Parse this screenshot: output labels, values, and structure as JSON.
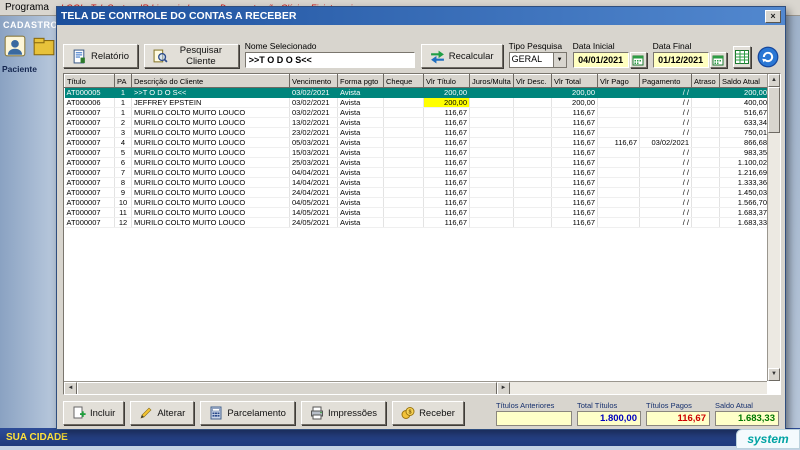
{
  "colors": {
    "titlebar_start": "#1c4f9c",
    "titlebar_end": "#5288cf",
    "selected_row": "#00857c",
    "highlight_yellow": "#ffff00",
    "date_field_bg": "#ffffc0",
    "summary_box_bg": "#ffffc8",
    "statusbar_bg": "#203a7c",
    "status_text": "#ffe23c"
  },
  "app": {
    "menu": "Programa",
    "license_text": "LOGI - TelaSystem IR  Licenciado para: Demonstração Clínica Fisioterapia",
    "sidebar": {
      "group": "CADASTROS",
      "item": "Paciente"
    },
    "statusbar_text": "SUA CIDADE",
    "logo_text": "system"
  },
  "dialog": {
    "title": "TELA DE CONTROLE DO CONTAS A RECEBER",
    "toolbar": {
      "relatorio": "Relatório",
      "pesquisar": "Pesquisar Cliente",
      "nome_label": "Nome Selecionado",
      "nome_value": ">>T O D O S<<",
      "recalcular": "Recalcular",
      "tipo_label": "Tipo Pesquisa",
      "tipo_value": "GERAL",
      "data_inicial_label": "Data Inicial",
      "data_inicial": "04/01/2021",
      "data_final_label": "Data Final",
      "data_final": "01/12/2021"
    },
    "grid": {
      "columns": [
        "Título",
        "PA",
        "Descrição do Cliente",
        "Vencimento",
        "Forma pgto",
        "Cheque",
        "Vlr Título",
        "Juros/Multa",
        "Vlr Desc.",
        "Vlr Total",
        "Vlr Pago",
        "Pagamento",
        "Atraso",
        "Saldo Atual"
      ],
      "selected_row_index": 0,
      "highlighted_cell": {
        "row": 1,
        "col": 6,
        "color": "#ffff00"
      },
      "rows": [
        [
          "AT000005",
          "1",
          ">>T O D O S<<",
          "03/02/2021",
          "Avista",
          "",
          "200,00",
          "",
          "",
          "200,00",
          "",
          "/ /",
          "",
          "200,00"
        ],
        [
          "AT000006",
          "1",
          "JEFFREY EPSTEIN",
          "03/02/2021",
          "Avista",
          "",
          "200,00",
          "",
          "",
          "200,00",
          "",
          "/ /",
          "",
          "400,00"
        ],
        [
          "AT000007",
          "1",
          "MURILO COLTO MUITO LOUCO",
          "03/02/2021",
          "Avista",
          "",
          "116,67",
          "",
          "",
          "116,67",
          "",
          "/ /",
          "",
          "516,67"
        ],
        [
          "AT000007",
          "2",
          "MURILO COLTO MUITO LOUCO",
          "13/02/2021",
          "Avista",
          "",
          "116,67",
          "",
          "",
          "116,67",
          "",
          "/ /",
          "",
          "633,34"
        ],
        [
          "AT000007",
          "3",
          "MURILO COLTO MUITO LOUCO",
          "23/02/2021",
          "Avista",
          "",
          "116,67",
          "",
          "",
          "116,67",
          "",
          "/ /",
          "",
          "750,01"
        ],
        [
          "AT000007",
          "4",
          "MURILO COLTO MUITO LOUCO",
          "05/03/2021",
          "Avista",
          "",
          "116,67",
          "",
          "",
          "116,67",
          "116,67",
          "03/02/2021",
          "",
          "866,68"
        ],
        [
          "AT000007",
          "5",
          "MURILO COLTO MUITO LOUCO",
          "15/03/2021",
          "Avista",
          "",
          "116,67",
          "",
          "",
          "116,67",
          "",
          "/ /",
          "",
          "983,35"
        ],
        [
          "AT000007",
          "6",
          "MURILO COLTO MUITO LOUCO",
          "25/03/2021",
          "Avista",
          "",
          "116,67",
          "",
          "",
          "116,67",
          "",
          "/ /",
          "",
          "1.100,02"
        ],
        [
          "AT000007",
          "7",
          "MURILO COLTO MUITO LOUCO",
          "04/04/2021",
          "Avista",
          "",
          "116,67",
          "",
          "",
          "116,67",
          "",
          "/ /",
          "",
          "1.216,69"
        ],
        [
          "AT000007",
          "8",
          "MURILO COLTO MUITO LOUCO",
          "14/04/2021",
          "Avista",
          "",
          "116,67",
          "",
          "",
          "116,67",
          "",
          "/ /",
          "",
          "1.333,36"
        ],
        [
          "AT000007",
          "9",
          "MURILO COLTO MUITO LOUCO",
          "24/04/2021",
          "Avista",
          "",
          "116,67",
          "",
          "",
          "116,67",
          "",
          "/ /",
          "",
          "1.450,03"
        ],
        [
          "AT000007",
          "10",
          "MURILO COLTO MUITO LOUCO",
          "04/05/2021",
          "Avista",
          "",
          "116,67",
          "",
          "",
          "116,67",
          "",
          "/ /",
          "",
          "1.566,70"
        ],
        [
          "AT000007",
          "11",
          "MURILO COLTO MUITO LOUCO",
          "14/05/2021",
          "Avista",
          "",
          "116,67",
          "",
          "",
          "116,67",
          "",
          "/ /",
          "",
          "1.683,37"
        ],
        [
          "AT000007",
          "12",
          "MURILO COLTO MUITO LOUCO",
          "24/05/2021",
          "Avista",
          "",
          "116,67",
          "",
          "",
          "116,67",
          "",
          "/ /",
          "",
          "1.683,33"
        ]
      ]
    },
    "footer": {
      "buttons": [
        "Incluir",
        "Alterar",
        "Parcelamento",
        "Impressões",
        "Receber"
      ],
      "summary": [
        {
          "label": "Títulos Anteriores",
          "value": "",
          "value_color": "#000000"
        },
        {
          "label": "Total Títulos",
          "value": "1.800,00",
          "value_color": "#0000c0"
        },
        {
          "label": "Títulos Pagos",
          "value": "116,67",
          "value_color": "#cc0000"
        },
        {
          "label": "Saldo Atual",
          "value": "1.683,33",
          "value_color": "#007700"
        }
      ]
    }
  }
}
